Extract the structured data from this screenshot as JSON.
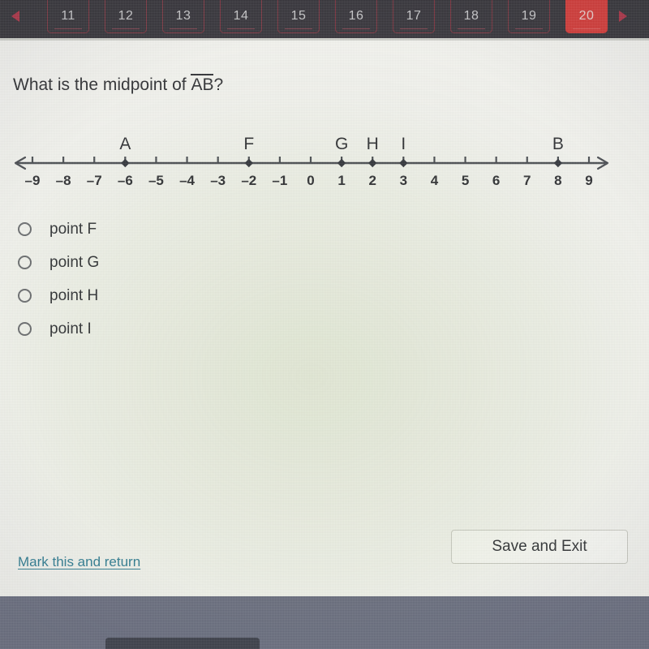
{
  "tabbar": {
    "prev_arrow": "◀",
    "next_arrow": "▶",
    "tabs": [
      {
        "label": "11",
        "active": false
      },
      {
        "label": "12",
        "active": false
      },
      {
        "label": "13",
        "active": false
      },
      {
        "label": "14",
        "active": false
      },
      {
        "label": "15",
        "active": false
      },
      {
        "label": "16",
        "active": false
      },
      {
        "label": "17",
        "active": false
      },
      {
        "label": "18",
        "active": false
      },
      {
        "label": "19",
        "active": false
      },
      {
        "label": "20",
        "active": true
      }
    ],
    "active_tab": "20",
    "active_color": "#d33b39",
    "bar_color": "#36343a"
  },
  "question": {
    "text_before": "What is the midpoint of ",
    "segment": "AB",
    "text_after": "?",
    "full_text": "What is the midpoint of AB?"
  },
  "chart_data": {
    "type": "number-line",
    "title": "",
    "xlabel": "",
    "axis_min": -9,
    "axis_max": 9,
    "tick_step": 1,
    "tick_labels": [
      "–9",
      "–8",
      "–7",
      "–6",
      "–5",
      "–4",
      "–3",
      "–2",
      "–1",
      "0",
      "1",
      "2",
      "3",
      "4",
      "5",
      "6",
      "7",
      "8",
      "9"
    ],
    "tick_values": [
      -9,
      -8,
      -7,
      -6,
      -5,
      -4,
      -3,
      -2,
      -1,
      0,
      1,
      2,
      3,
      4,
      5,
      6,
      7,
      8,
      9
    ],
    "left_arrow": true,
    "right_arrow": true,
    "points": [
      {
        "label": "A",
        "value": -6
      },
      {
        "label": "F",
        "value": -2
      },
      {
        "label": "G",
        "value": 1
      },
      {
        "label": "H",
        "value": 2
      },
      {
        "label": "I",
        "value": 3
      },
      {
        "label": "B",
        "value": 8
      }
    ],
    "marker_shape": "diamond",
    "line_color": "#4a4d52",
    "text_color": "#2f3033"
  },
  "choices": {
    "options": [
      {
        "label": "point F",
        "selected": false
      },
      {
        "label": "point G",
        "selected": false
      },
      {
        "label": "point H",
        "selected": false
      },
      {
        "label": "point I",
        "selected": false
      }
    ]
  },
  "footer": {
    "mark_return_label": "Mark this and return",
    "mark_return_color": "#2f7c92",
    "save_exit_label": "Save and Exit"
  }
}
